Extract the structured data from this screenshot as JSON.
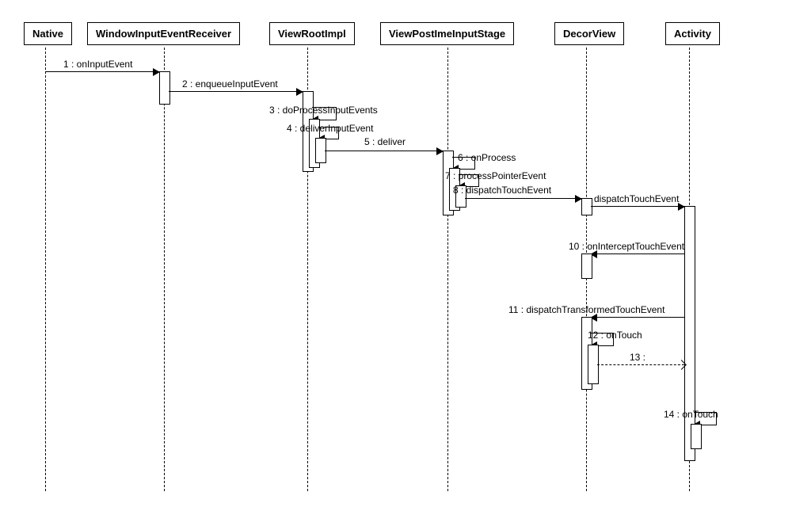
{
  "participants": {
    "p0": "Native",
    "p1": "WindowInputEventReceiver",
    "p2": "ViewRootImpl",
    "p3": "ViewPostImeInputStage",
    "p4": "DecorView",
    "p5": "Activity"
  },
  "messages": {
    "m1": "1 : onInputEvent",
    "m2": "2 : enqueueInputEvent",
    "m3": "3 : doProcessInputEvents",
    "m4": "4 : deliverInputEvent",
    "m5": "5 : deliver",
    "m6": "6 : onProcess",
    "m7": "7 : processPointerEvent",
    "m8": "8 : dispatchTouchEvent",
    "m9": "dispatchTouchEvent",
    "m10": "10 : onInterceptTouchEvent",
    "m11": "11 : dispatchTransformedTouchEvent",
    "m12": "12 : onTouch",
    "m13": "13 :",
    "m14": "14 : onTouch"
  },
  "chart_data": {
    "type": "sequence-diagram",
    "participants": [
      "Native",
      "WindowInputEventReceiver",
      "ViewRootImpl",
      "ViewPostImeInputStage",
      "DecorView",
      "Activity"
    ],
    "messages": [
      {
        "seq": 1,
        "from": "Native",
        "to": "WindowInputEventReceiver",
        "label": "onInputEvent"
      },
      {
        "seq": 2,
        "from": "WindowInputEventReceiver",
        "to": "ViewRootImpl",
        "label": "enqueueInputEvent"
      },
      {
        "seq": 3,
        "from": "ViewRootImpl",
        "to": "ViewRootImpl",
        "label": "doProcessInputEvents"
      },
      {
        "seq": 4,
        "from": "ViewRootImpl",
        "to": "ViewRootImpl",
        "label": "deliverInputEvent"
      },
      {
        "seq": 5,
        "from": "ViewRootImpl",
        "to": "ViewPostImeInputStage",
        "label": "deliver"
      },
      {
        "seq": 6,
        "from": "ViewPostImeInputStage",
        "to": "ViewPostImeInputStage",
        "label": "onProcess"
      },
      {
        "seq": 7,
        "from": "ViewPostImeInputStage",
        "to": "ViewPostImeInputStage",
        "label": "processPointerEvent"
      },
      {
        "seq": 8,
        "from": "ViewPostImeInputStage",
        "to": "DecorView",
        "label": "dispatchTouchEvent"
      },
      {
        "seq": 9,
        "from": "DecorView",
        "to": "Activity",
        "label": "dispatchTouchEvent"
      },
      {
        "seq": 10,
        "from": "Activity",
        "to": "DecorView",
        "label": "onInterceptTouchEvent"
      },
      {
        "seq": 11,
        "from": "Activity",
        "to": "DecorView",
        "label": "dispatchTransformedTouchEvent"
      },
      {
        "seq": 12,
        "from": "DecorView",
        "to": "DecorView",
        "label": "onTouch"
      },
      {
        "seq": 13,
        "from": "DecorView",
        "to": "Activity",
        "label": "",
        "dashed": true
      },
      {
        "seq": 14,
        "from": "Activity",
        "to": "Activity",
        "label": "onTouch"
      }
    ]
  }
}
